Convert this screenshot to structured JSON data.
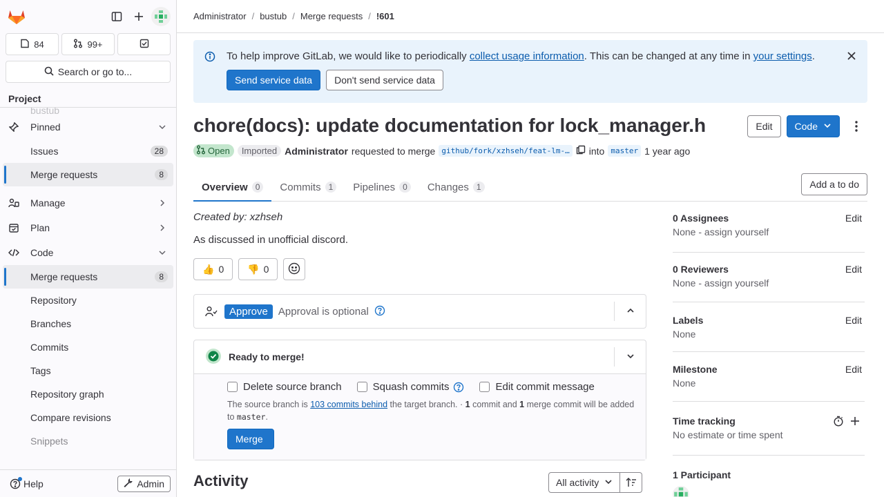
{
  "header": {
    "breadcrumbs": [
      "Administrator",
      "bustub",
      "Merge requests",
      "!601"
    ]
  },
  "sidebar": {
    "counts": {
      "issues": "84",
      "merge_requests": "99+"
    },
    "search_label": "Search or go to...",
    "context_label": "Project",
    "ghost_item": "bustub",
    "items": [
      {
        "label": "Pinned",
        "type": "group"
      },
      {
        "label": "Issues",
        "badge": "28",
        "type": "sub"
      },
      {
        "label": "Merge requests",
        "badge": "8",
        "type": "sub"
      },
      {
        "label": "Manage",
        "type": "group"
      },
      {
        "label": "Plan",
        "type": "group"
      },
      {
        "label": "Code",
        "type": "group"
      },
      {
        "label": "Merge requests",
        "badge": "8",
        "type": "sub"
      },
      {
        "label": "Repository",
        "type": "sub"
      },
      {
        "label": "Branches",
        "type": "sub"
      },
      {
        "label": "Commits",
        "type": "sub"
      },
      {
        "label": "Tags",
        "type": "sub"
      },
      {
        "label": "Repository graph",
        "type": "sub"
      },
      {
        "label": "Compare revisions",
        "type": "sub"
      },
      {
        "label": "Snippets",
        "type": "sub"
      }
    ],
    "help_label": "Help",
    "admin_label": "Admin"
  },
  "banner": {
    "text_before": "To help improve GitLab, we would like to periodically ",
    "link1": "collect usage information",
    "text_middle": ". This can be changed at any time in ",
    "link2": "your settings",
    "text_after": ".",
    "send_label": "Send service data",
    "dont_send_label": "Don't send service data"
  },
  "mr": {
    "title": "chore(docs): update documentation for lock_manager.h",
    "edit_label": "Edit",
    "code_label": "Code",
    "status": "Open",
    "imported": "Imported",
    "author": "Administrator",
    "requested_text": "requested to merge",
    "source_branch": "github/fork/xzhseh/feat-lm-…",
    "into_text": "into",
    "target_branch": "master",
    "time_ago": "1 year ago"
  },
  "tabs": [
    {
      "label": "Overview",
      "count": "0"
    },
    {
      "label": "Commits",
      "count": "1"
    },
    {
      "label": "Pipelines",
      "count": "0"
    },
    {
      "label": "Changes",
      "count": "1"
    }
  ],
  "todo_label": "Add a to do",
  "description": {
    "created_by": "Created by: xzhseh",
    "body": "As discussed in unofficial discord."
  },
  "reactions": [
    {
      "emoji": "👍",
      "count": "0"
    },
    {
      "emoji": "👎",
      "count": "0"
    }
  ],
  "approval": {
    "approve_label": "Approve",
    "optional_text": "Approval is optional"
  },
  "merge": {
    "ready_text": "Ready to merge!",
    "delete_branch": "Delete source branch",
    "squash": "Squash commits",
    "edit_message": "Edit commit message",
    "note_before": "The source branch is ",
    "behind_link": "103 commits behind",
    "note_middle": " the target branch. · ",
    "commit_count": "1",
    "note_commit": " commit and ",
    "merge_commit_count": "1",
    "note_merge": " merge commit will be added to ",
    "note_branch": "master",
    "note_end": ".",
    "merge_label": "Merge"
  },
  "activity": {
    "title": "Activity",
    "filter": "All activity"
  },
  "right_sidebar": {
    "assignees_title": "0 Assignees",
    "assignees_value": "None - assign yourself",
    "reviewers_title": "0 Reviewers",
    "reviewers_value": "None - assign yourself",
    "labels_title": "Labels",
    "labels_value": "None",
    "milestone_title": "Milestone",
    "milestone_value": "None",
    "time_title": "Time tracking",
    "time_value": "No estimate or time spent",
    "participants_title": "1 Participant",
    "edit_label": "Edit"
  },
  "colors": {
    "primary": "#1f75cb",
    "open_badge_bg": "#c3e6cd",
    "banner_bg": "#e9f3fc",
    "success": "#108548"
  }
}
